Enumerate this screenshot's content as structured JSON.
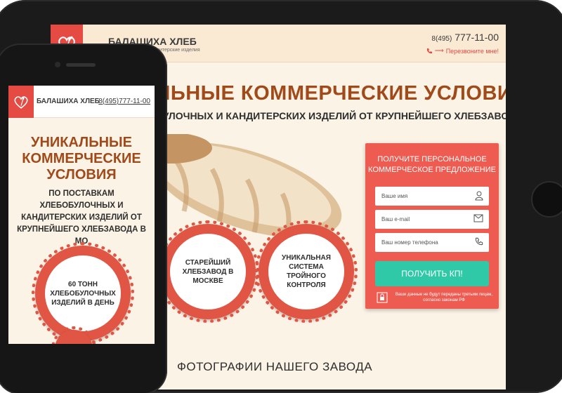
{
  "tablet": {
    "brand": "БАЛАШИХА ХЛЕБ",
    "brand_sub": "кондитерские изделия",
    "phone_code": "8(495)",
    "phone_number": "777-11-00",
    "callback": "Перезвоните мне!",
    "hero_title": "ЛЬНЫЕ КОММЕРЧЕСКИЕ УСЛОВИЯ",
    "hero_sub": "БУЛОЧНЫХ И КАНДИТЕРСКИХ ИЗДЕЛИЙ ОТ КРУПНЕЙШЕГО ХЛЕБЗАВОДА В МО",
    "badges": [
      "СТАРЕЙШИЙ ХЛЕБЗАВОД В МОСКВЕ",
      "УНИКАЛЬНАЯ СИСТЕМА ТРОЙНОГО КОНТРОЛЯ"
    ],
    "form": {
      "title_line1": "ПОЛУЧИТЕ ПЕРСОНАЛЬНОЕ",
      "title_line2": "КОММЕРЧЕСКОЕ ПРЕДЛОЖЕНИЕ",
      "name_placeholder": "Ваше имя",
      "email_placeholder": "Ваш e-mail",
      "phone_placeholder": "Ваш номер телефона",
      "submit": "ПОЛУЧИТЬ КП!",
      "note": "Ваши данные не будут переданы третьим лицам, согласно законам РФ"
    },
    "section_title": "ФОТОГРАФИИ НАШЕГО ЗАВОДА"
  },
  "phone": {
    "brand": "БАЛАШИХА ХЛЕБ",
    "phone": "8(495)777-11-00",
    "title": "УНИКАЛЬНЫЕ КОММЕРЧЕСКИЕ УСЛОВИЯ",
    "subtitle": "ПО ПОСТАВКАМ ХЛЕБОБУЛОЧНЫХ И КАНДИТЕРСКИХ ИЗДЕЛИЙ ОТ КРУПНЕЙШЕГО ХЛЕБЗАВОДА В МО",
    "badge": "60 ТОНН ХЛЕБОБУЛОЧНЫХ ИЗДЕЛИЙ В ДЕНЬ"
  },
  "colors": {
    "accent_red": "#e54a43",
    "title_brown": "#a04a1a",
    "submit_green": "#2fc9a7",
    "header_beige": "#fae9d3"
  },
  "icons": [
    "wheat-heart-logo-icon",
    "phone-icon",
    "user-icon",
    "envelope-icon",
    "lock-icon"
  ]
}
